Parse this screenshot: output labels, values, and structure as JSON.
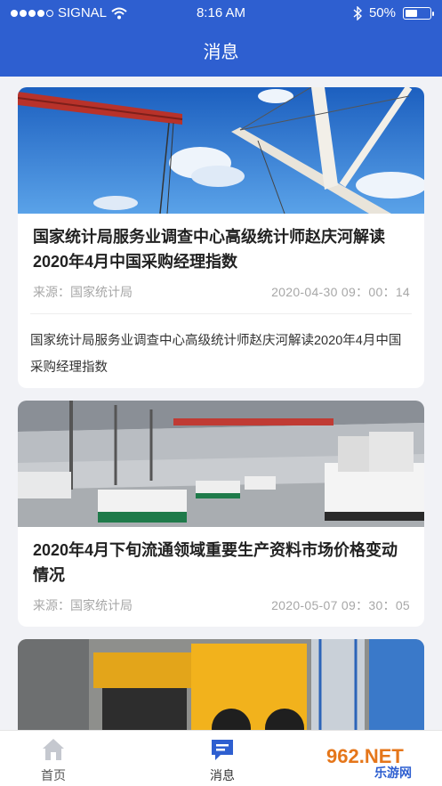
{
  "status_bar": {
    "carrier": "SIGNAL",
    "time": "8:16 AM",
    "battery": "50%",
    "battery_level": 0.5
  },
  "header": {
    "title": "消息"
  },
  "articles": [
    {
      "title": "国家统计局服务业调查中心高级统计师赵庆河解读2020年4月中国采购经理指数",
      "source": "来源：国家统计局",
      "date": "2020-04-30  09：00：14",
      "summary": "国家统计局服务业调查中心高级统计师赵庆河解读2020年4月中国采购经理指数"
    },
    {
      "title": "2020年4月下旬流通领域重要生产资料市场价格变动情况",
      "source": "来源：国家统计局",
      "date": "2020-05-07  09：30：05"
    }
  ],
  "tabbar": {
    "home_label": "首页",
    "message_label": "消息"
  },
  "watermark": {
    "number": "962.NET",
    "text": "乐游网"
  },
  "colors": {
    "brand": "#2e5fd0",
    "background": "#f1f2f6"
  }
}
